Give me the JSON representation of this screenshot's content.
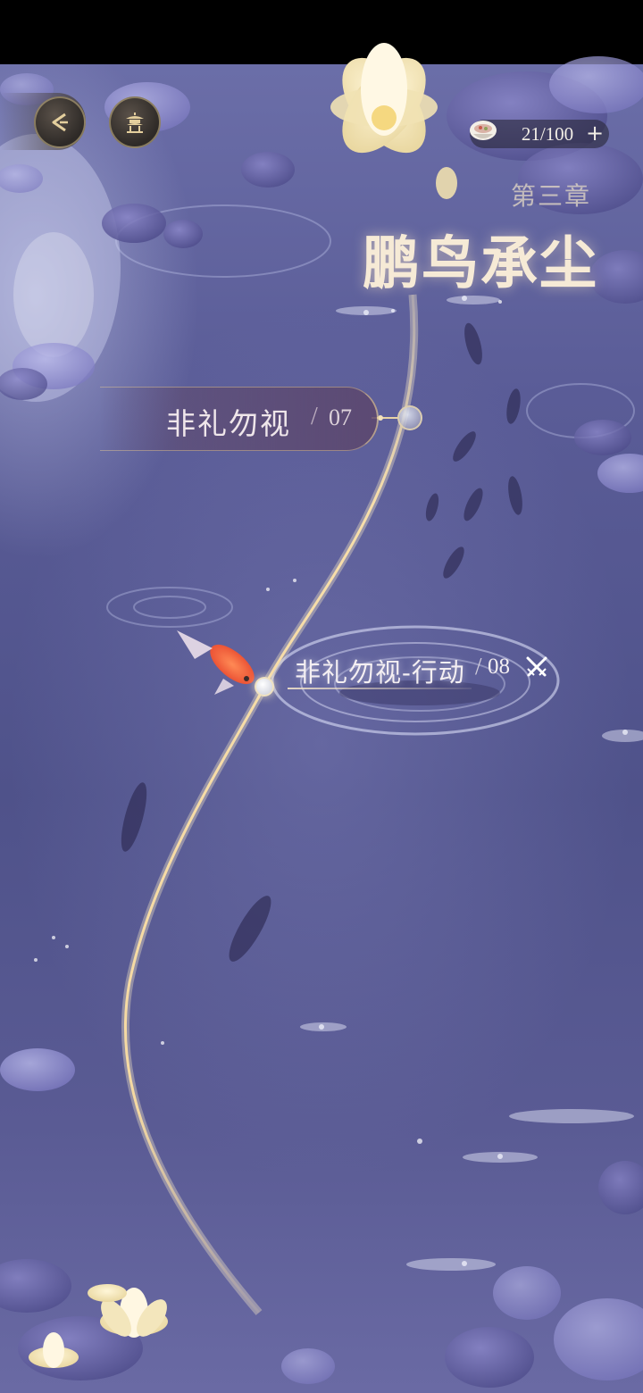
{
  "hud": {
    "back_icon": "back-arrow-icon",
    "pavilion_icon": "pavilion-icon",
    "currency": {
      "icon": "bowl-icon",
      "value": "21/100",
      "add_label": "+"
    }
  },
  "chapter": {
    "subtitle": "第三章",
    "title": "鹏鸟承尘"
  },
  "stages": [
    {
      "name": "非礼勿视",
      "slash": "/",
      "number": "07"
    },
    {
      "name": "非礼勿视-行动",
      "slash": "/",
      "number": "08",
      "icon": "crossed-swords-icon"
    }
  ],
  "colors": {
    "water": "#5a5c97",
    "path_gold": "#f0d49a",
    "text_light": "#f6ead6"
  }
}
